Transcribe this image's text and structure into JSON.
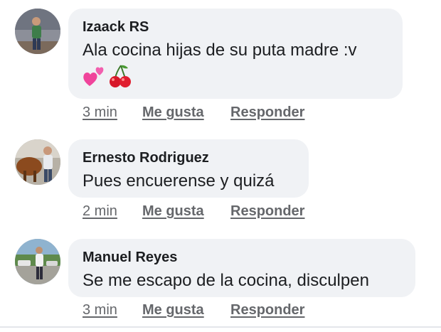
{
  "comments": [
    {
      "author": "Izaack RS",
      "text": "Ala cocina hijas de su puta madre :v",
      "emojis": [
        "two-hearts-icon",
        "cherries-icon"
      ],
      "time": "3 min",
      "like_label": "Me gusta",
      "reply_label": "Responder"
    },
    {
      "author": "Ernesto Rodriguez",
      "text": "Pues encuerense y quizá",
      "time": "2 min",
      "like_label": "Me gusta",
      "reply_label": "Responder"
    },
    {
      "author": "Manuel Reyes",
      "text": "Se me escapo de la cocina, disculpen",
      "time": "3 min",
      "like_label": "Me gusta",
      "reply_label": "Responder"
    }
  ],
  "colors": {
    "bubble": "#f0f2f5",
    "text": "#1c1e21",
    "meta": "#65676b"
  }
}
